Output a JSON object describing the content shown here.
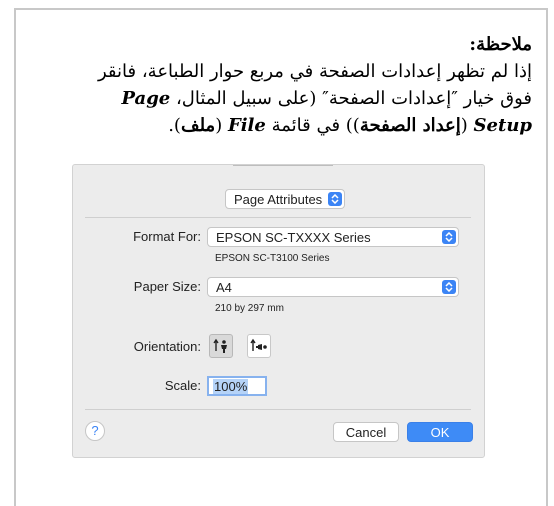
{
  "note": {
    "title": "ملاحظة:",
    "line1": "إذا لم تظهر إعدادات الصفحة في مربع حوار الطباعة، فانقر",
    "line2_a": "فوق خيار ″إعدادات الصفحة″ (على سبيل المثال، ",
    "line2_b": "Page",
    "line3_a": "Setup",
    "line3_b": " (",
    "line3_c": "إعداد الصفحة",
    "line3_d": ")) في قائمة ",
    "line3_e": "File",
    "line3_f": " (",
    "line3_g": "ملف",
    "line3_h": ")."
  },
  "dialog": {
    "attributes_popup": "Page Attributes",
    "format_label": "Format For:",
    "format_value": "EPSON SC-TXXXX Series",
    "format_sub": "EPSON SC-T3100 Series",
    "paper_label": "Paper Size:",
    "paper_value": "A4",
    "paper_sub": "210 by 297 mm",
    "orientation_label": "Orientation:",
    "scale_label": "Scale:",
    "scale_value": "100%",
    "help_label": "?",
    "cancel_label": "Cancel",
    "ok_label": "OK"
  },
  "colors": {
    "accent": "#3e8bf6"
  }
}
